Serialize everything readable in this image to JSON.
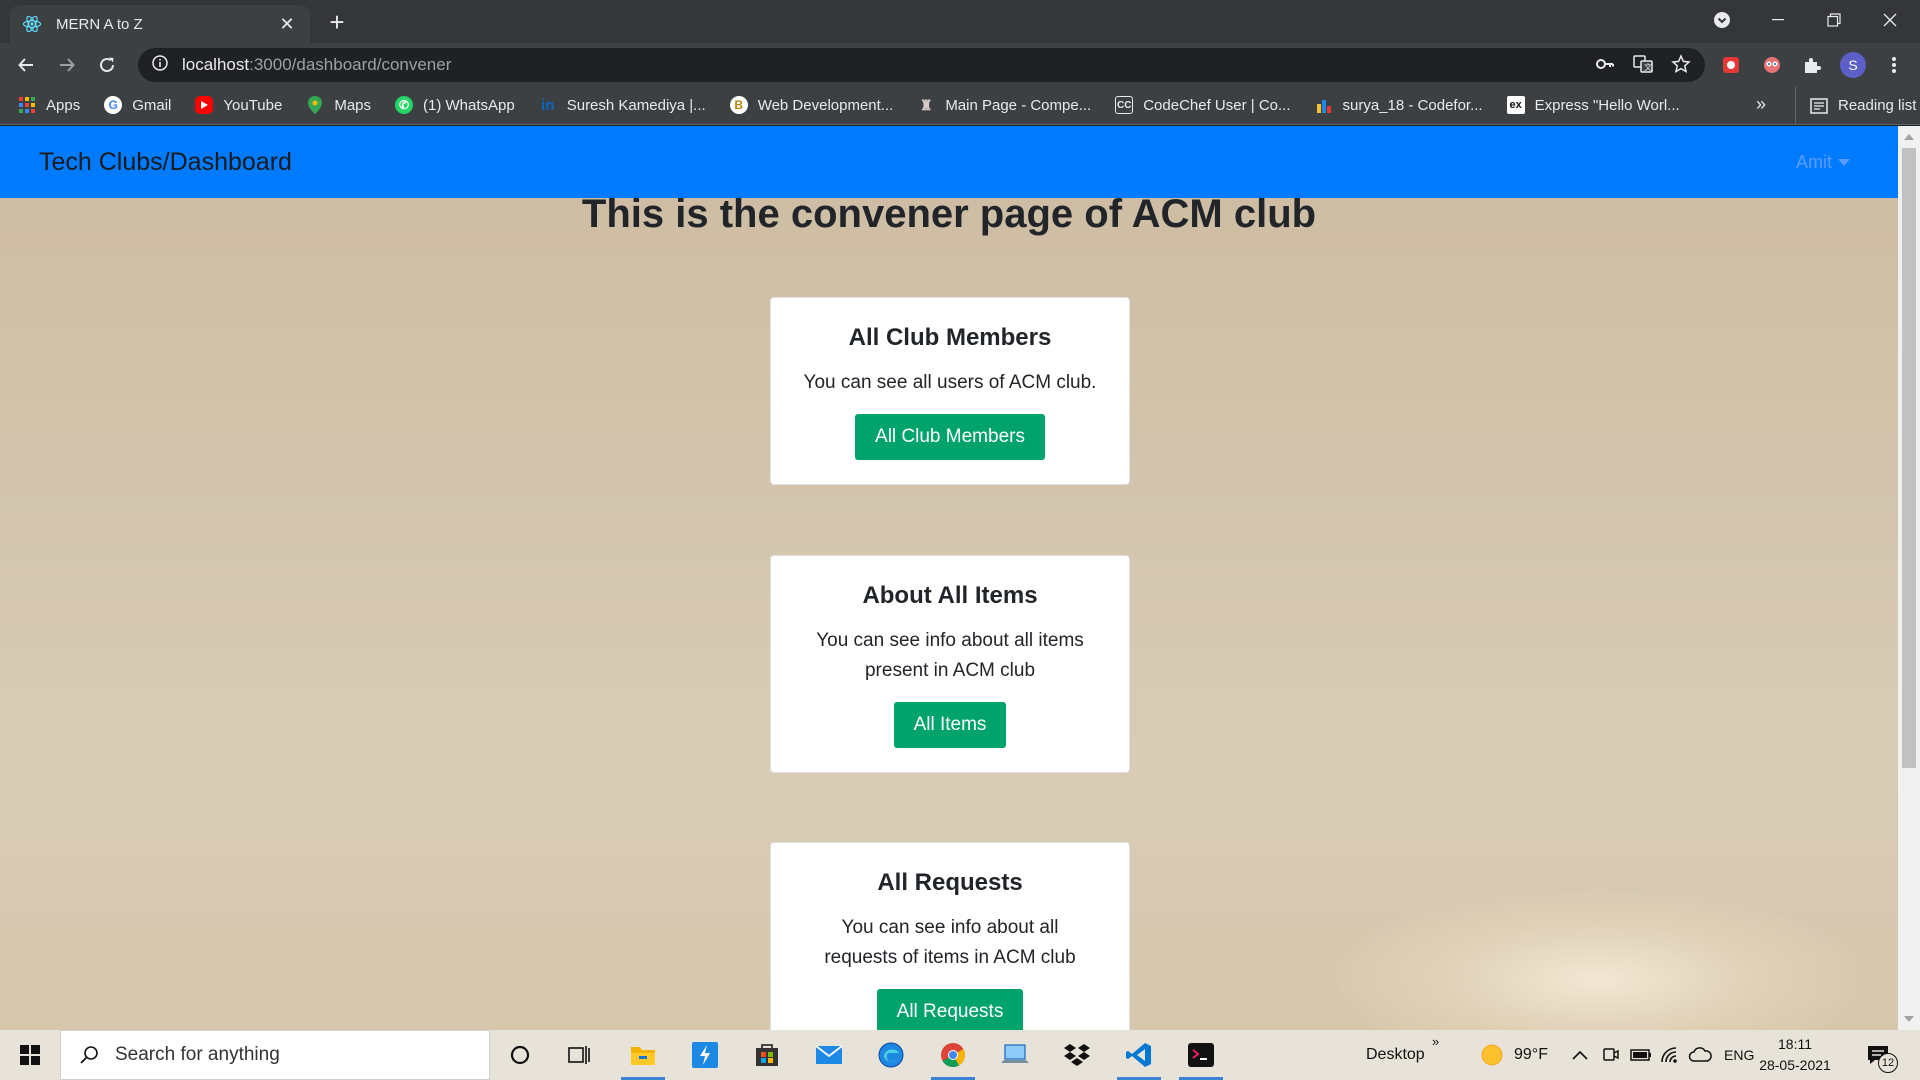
{
  "browser": {
    "tab_title": "MERN A to Z",
    "new_tab": "+",
    "url_host": "localhost",
    "url_path": ":3000/dashboard/convener",
    "bookmarks": [
      {
        "label": "Apps",
        "icon": "apps-grid-icon"
      },
      {
        "label": "Gmail",
        "icon": "google-icon"
      },
      {
        "label": "YouTube",
        "icon": "youtube-icon"
      },
      {
        "label": "Maps",
        "icon": "maps-icon"
      },
      {
        "label": "(1) WhatsApp",
        "icon": "whatsapp-icon"
      },
      {
        "label": "Suresh Kamediya |...",
        "icon": "linkedin-icon"
      },
      {
        "label": "Web Development...",
        "icon": "bookmark-site-icon"
      },
      {
        "label": "Main Page - Compe...",
        "icon": "wiki-icon"
      },
      {
        "label": "CodeChef User | Co...",
        "icon": "codechef-icon"
      },
      {
        "label": "surya_18 - Codefor...",
        "icon": "codeforces-icon"
      },
      {
        "label": "Express \"Hello Worl...",
        "icon": "express-icon"
      }
    ],
    "bookmarks_more": "»",
    "reading_list": "Reading list",
    "profile_initial": "S"
  },
  "page": {
    "brand": "Tech Clubs/Dashboard",
    "user_name": "Amit",
    "heading": "This is the convener page of ACM club",
    "cards": [
      {
        "title": "All Club Members",
        "text": "You can see all users of ACM club.",
        "button": "All Club Members"
      },
      {
        "title": "About All Items",
        "text": "You can see info about all items present in ACM club",
        "button": "All Items"
      },
      {
        "title": "All Requests",
        "text": "You can see info about all requests of items in ACM club",
        "button": "All Requests"
      }
    ],
    "colors": {
      "navbar": "#007bff",
      "button": "#00a36c"
    }
  },
  "taskbar": {
    "search_placeholder": "Search for anything",
    "desktop_label": "Desktop",
    "chevron": "»",
    "temperature": "99°F",
    "language": "ENG",
    "time": "18:11",
    "date": "28-05-2021",
    "notification_count": "12"
  }
}
